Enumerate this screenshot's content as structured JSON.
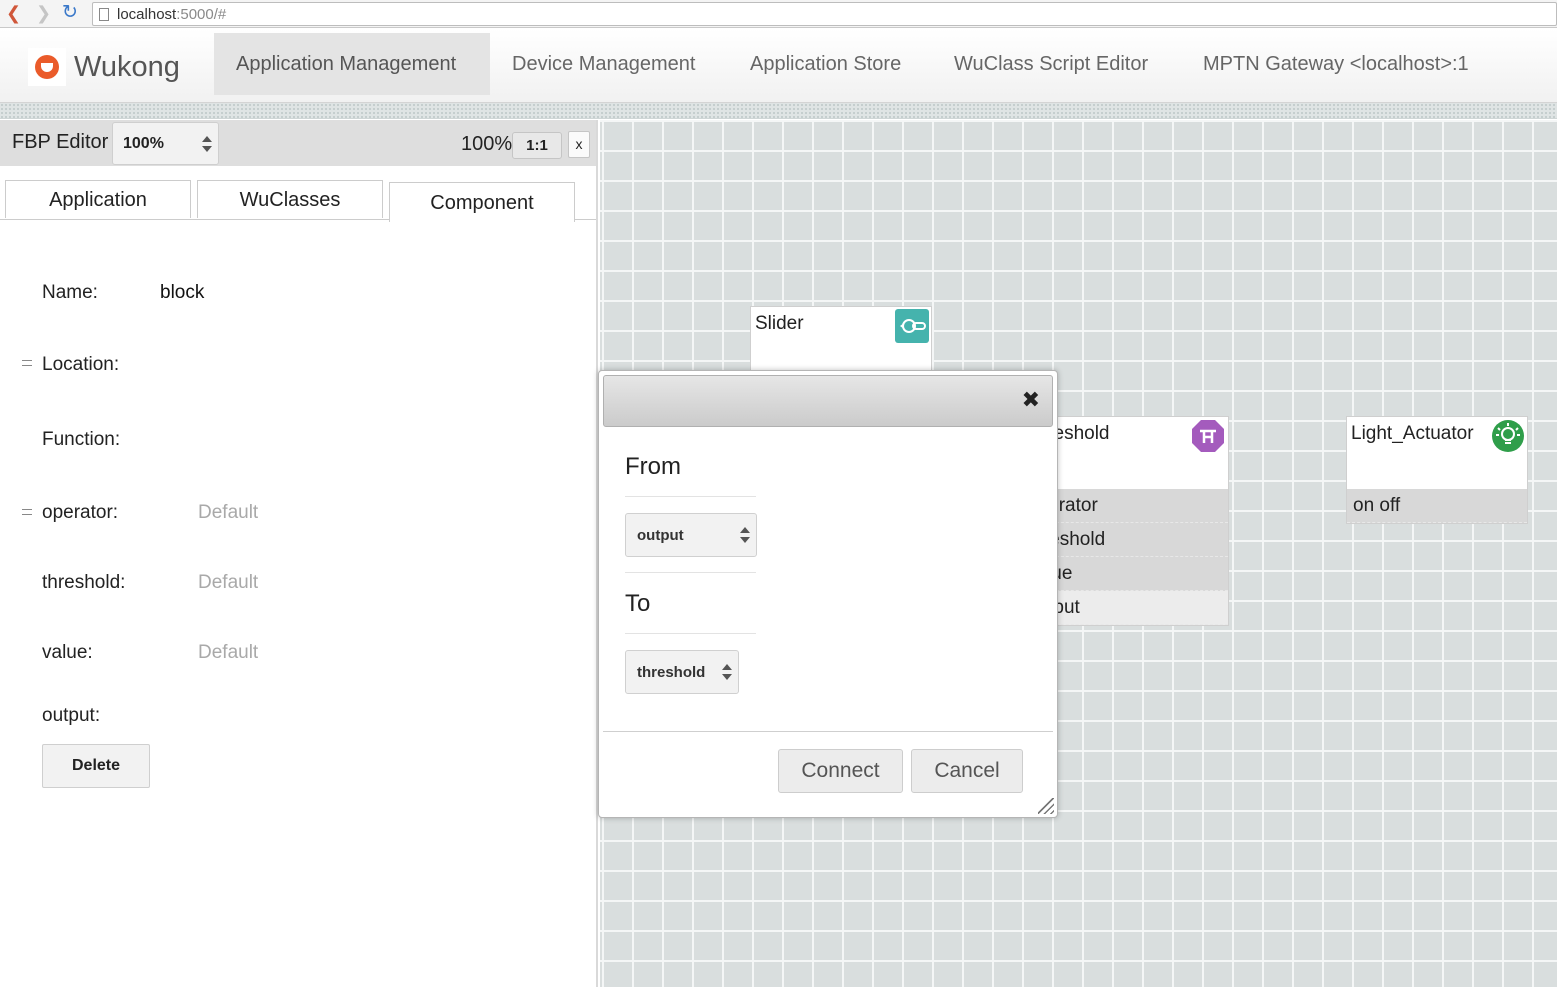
{
  "browser": {
    "url_host": "localhost",
    "url_rest": ":5000/#"
  },
  "navbar": {
    "brand": "Wukong",
    "items": [
      {
        "label": "Application Management"
      },
      {
        "label": "Device Management"
      },
      {
        "label": "Application Store"
      },
      {
        "label": "WuClass Script Editor"
      },
      {
        "label": "MPTN Gateway <localhost>:1"
      }
    ],
    "active_index": 0
  },
  "editor": {
    "title": "FBP Editor",
    "zoom_select": "100%",
    "zoom_readout": "100%",
    "reset_label": "1:1",
    "close_label": "x"
  },
  "tabs": [
    {
      "label": "Application"
    },
    {
      "label": "WuClasses"
    },
    {
      "label": "Component"
    }
  ],
  "properties": {
    "name_label": "Name:",
    "name_value": "block",
    "location_label": "Location:",
    "function_label": "Function:",
    "operator_label": "operator:",
    "operator_value": "Default",
    "threshold_label": "threshold:",
    "threshold_value": "Default",
    "value_label": "value:",
    "value_value": "Default",
    "output_label": "output:",
    "delete_label": "Delete"
  },
  "canvas": {
    "nodes": {
      "slider": {
        "title": "Slider",
        "icon": "slider-icon",
        "icon_color": "#45b3ad"
      },
      "threshold": {
        "title": "Threshold",
        "icon": "threshold-icon",
        "icon_color": "#a45bbd",
        "ports": [
          "operator",
          "threshold",
          "value",
          "output"
        ]
      },
      "light_actuator": {
        "title": "Light_Actuator",
        "icon": "lightbulb-icon",
        "icon_color": "#2f9e4a",
        "ports": [
          "on off"
        ]
      }
    }
  },
  "dialog": {
    "close_glyph": "✖",
    "from_label": "From",
    "from_selected": "output",
    "to_label": "To",
    "to_selected": "threshold",
    "connect_label": "Connect",
    "cancel_label": "Cancel"
  }
}
